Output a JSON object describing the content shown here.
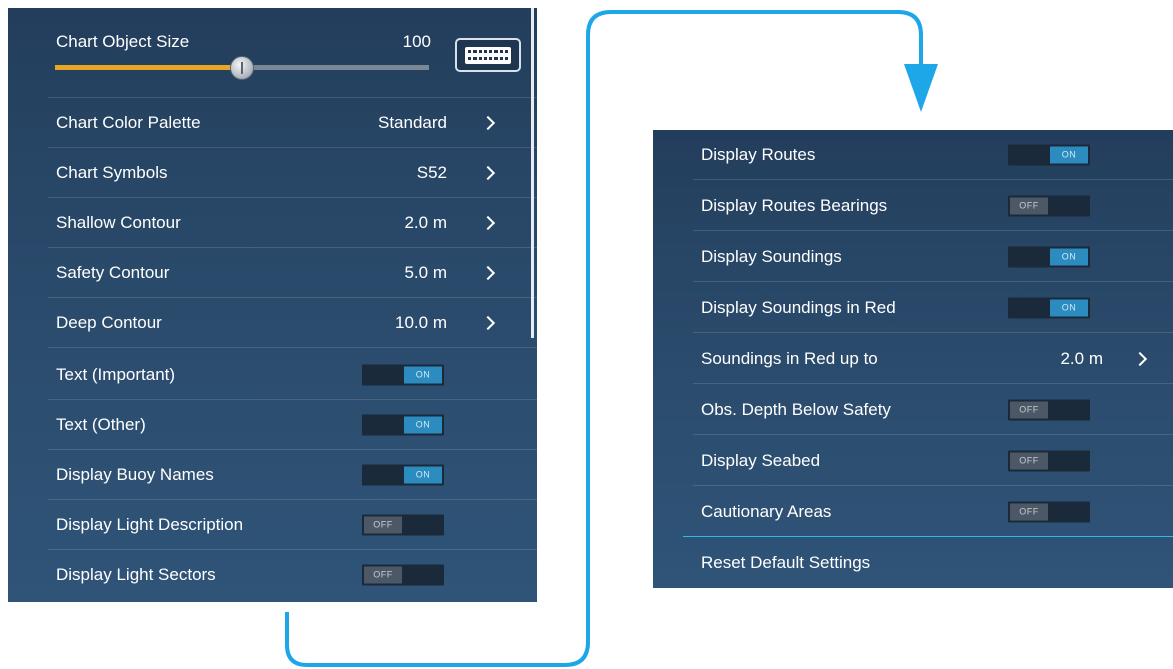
{
  "left_panel": {
    "object_size": {
      "label": "Chart Object Size",
      "value": "100",
      "level": 0.5
    },
    "items": [
      {
        "label": "Chart Color Palette",
        "value": "Standard"
      },
      {
        "label": "Chart Symbols",
        "value": "S52"
      },
      {
        "label": "Shallow Contour",
        "value": "2.0 m"
      },
      {
        "label": "Safety Contour",
        "value": "5.0 m"
      },
      {
        "label": "Deep Contour",
        "value": "10.0 m"
      }
    ],
    "toggles": [
      {
        "label": "Text (Important)",
        "state": "ON"
      },
      {
        "label": "Text (Other)",
        "state": "ON"
      },
      {
        "label": "Display Buoy Names",
        "state": "ON"
      },
      {
        "label": "Display Light Description",
        "state": "OFF"
      },
      {
        "label": "Display Light Sectors",
        "state": "OFF"
      }
    ]
  },
  "right_panel": {
    "toggles_top": [
      {
        "label": "Display Routes",
        "state": "ON"
      },
      {
        "label": "Display Routes Bearings",
        "state": "OFF"
      },
      {
        "label": "Display Soundings",
        "state": "ON"
      },
      {
        "label": "Display Soundings in Red",
        "state": "ON"
      }
    ],
    "soundings_red": {
      "label": "Soundings in Red up to",
      "value": "2.0 m"
    },
    "toggles_bottom": [
      {
        "label": "Obs. Depth Below Safety",
        "state": "OFF"
      },
      {
        "label": "Display Seabed",
        "state": "OFF"
      },
      {
        "label": "Cautionary Areas",
        "state": "OFF"
      }
    ],
    "reset": {
      "label": "Reset Default Settings"
    }
  },
  "colors": {
    "panel_bg": "#2a4a6b",
    "accent_blue": "#1ea7e8",
    "slider_fill": "#e8a626",
    "toggle_on": "#2c8bbf",
    "toggle_off": "#4c5866"
  }
}
